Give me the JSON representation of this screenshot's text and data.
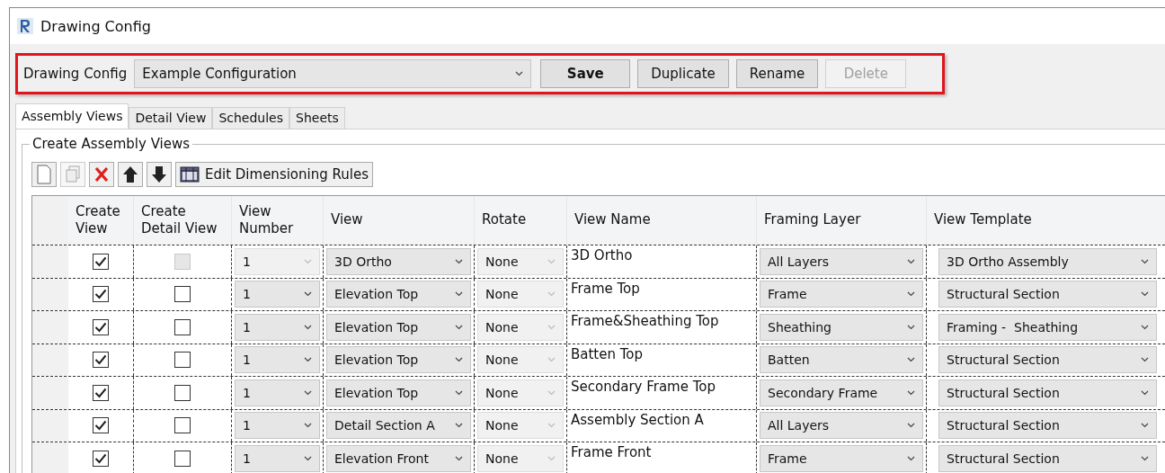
{
  "window": {
    "title": "Drawing Config"
  },
  "config_bar": {
    "label": "Drawing Config",
    "value": "Example Configuration",
    "buttons": [
      {
        "label": "Save",
        "kind": "default",
        "disabled": false
      },
      {
        "label": "Duplicate",
        "kind": "normal",
        "disabled": false
      },
      {
        "label": "Rename",
        "kind": "normal",
        "disabled": false
      },
      {
        "label": "Delete",
        "kind": "normal",
        "disabled": true
      }
    ]
  },
  "tabs": [
    {
      "label": "Assembly Views",
      "selected": true
    },
    {
      "label": "Detail View",
      "selected": false
    },
    {
      "label": "Schedules",
      "selected": false
    },
    {
      "label": "Sheets",
      "selected": false
    }
  ],
  "group": {
    "title": "Create Assembly Views",
    "toolbar": [
      {
        "kind": "new",
        "disabled": false
      },
      {
        "kind": "copy",
        "disabled": true
      },
      {
        "kind": "delete",
        "disabled": false
      },
      {
        "kind": "up",
        "disabled": false
      },
      {
        "kind": "down",
        "disabled": false
      },
      {
        "kind": "rules",
        "label": "Edit Dimensioning Rules",
        "disabled": false
      }
    ],
    "table": {
      "columns": [
        "Create View",
        "Create Detail View",
        "View Number",
        "View",
        "Rotate",
        "View Name",
        "Framing Layer",
        "View Template"
      ],
      "rows": [
        {
          "create_view": true,
          "create_detail_view": {
            "checked": false,
            "disabled": true
          },
          "view_number": {
            "value": "1",
            "disabled": true
          },
          "view": "3D Ortho",
          "rotate": {
            "value": "None",
            "disabled": true
          },
          "view_name": "3D Ortho",
          "framing_layer": "All Layers",
          "view_template": "3D Ortho Assembly"
        },
        {
          "create_view": true,
          "create_detail_view": {
            "checked": false,
            "disabled": false
          },
          "view_number": {
            "value": "1",
            "disabled": false
          },
          "view": "Elevation Top",
          "rotate": {
            "value": "None",
            "disabled": true
          },
          "view_name": "Frame Top",
          "framing_layer": "Frame",
          "view_template": "Structural Section"
        },
        {
          "create_view": true,
          "create_detail_view": {
            "checked": false,
            "disabled": false
          },
          "view_number": {
            "value": "1",
            "disabled": false
          },
          "view": "Elevation Top",
          "rotate": {
            "value": "None",
            "disabled": true
          },
          "view_name": "Frame&Sheathing Top",
          "framing_layer": "Sheathing",
          "view_template": "Framing -  Sheathing"
        },
        {
          "create_view": true,
          "create_detail_view": {
            "checked": false,
            "disabled": false
          },
          "view_number": {
            "value": "1",
            "disabled": false
          },
          "view": "Elevation Top",
          "rotate": {
            "value": "None",
            "disabled": true
          },
          "view_name": "Batten Top",
          "framing_layer": "Batten",
          "view_template": "Structural Section"
        },
        {
          "create_view": true,
          "create_detail_view": {
            "checked": false,
            "disabled": false
          },
          "view_number": {
            "value": "1",
            "disabled": false
          },
          "view": "Elevation Top",
          "rotate": {
            "value": "None",
            "disabled": true
          },
          "view_name": "Secondary Frame Top",
          "framing_layer": "Secondary Frame",
          "view_template": "Structural Section"
        },
        {
          "create_view": true,
          "create_detail_view": {
            "checked": false,
            "disabled": false
          },
          "view_number": {
            "value": "1",
            "disabled": false
          },
          "view": "Detail Section A",
          "rotate": {
            "value": "None",
            "disabled": true
          },
          "view_name": "Assembly Section A",
          "framing_layer": "All Layers",
          "view_template": "Structural Section"
        },
        {
          "create_view": true,
          "create_detail_view": {
            "checked": false,
            "disabled": false
          },
          "view_number": {
            "value": "1",
            "disabled": false
          },
          "view": "Elevation Front",
          "rotate": {
            "value": "None",
            "disabled": true
          },
          "view_name": "Frame Front",
          "framing_layer": "Frame",
          "view_template": "Structural Section"
        }
      ]
    }
  }
}
